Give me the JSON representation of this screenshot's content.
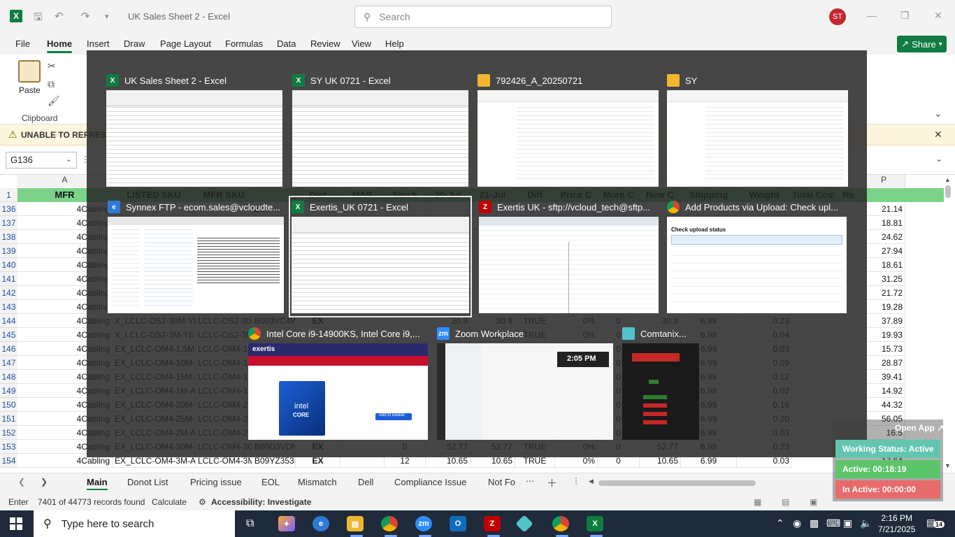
{
  "window": {
    "title": "UK Sales Sheet 2  -  Excel",
    "user_initials": "ST"
  },
  "search": {
    "placeholder": "Search"
  },
  "menu": [
    "File",
    "Home",
    "Insert",
    "Draw",
    "Page Layout",
    "Formulas",
    "Data",
    "Review",
    "View",
    "Help"
  ],
  "menu_active": "Home",
  "share_label": "Share",
  "ribbon": {
    "paste_label": "Paste",
    "clipboard_label": "Clipboard"
  },
  "warning": {
    "text": "UNABLE TO REFRES"
  },
  "namebox": "G136",
  "columns": {
    "A": "A",
    "P": "P"
  },
  "header_row": {
    "row_number": "1",
    "cells": [
      "MFR",
      "LISTED SKU",
      "MFR SKU",
      "",
      "Dist",
      "MAP",
      "Stock",
      "20-Jul",
      "21-Jul",
      "Diff",
      "Price C",
      "More C",
      "New C",
      "Shipping",
      "Weight",
      "Total Cost",
      "Re"
    ]
  },
  "rows": [
    {
      "n": "136",
      "mfr": "4Cabling",
      "listed": "",
      "mfrsku": "",
      "asin": "B00",
      "dist": "",
      "map": "",
      "stock": "",
      "jul20": "",
      "jul21": "",
      "diff": "",
      "pc": "",
      "mc": "",
      "newc": "",
      "ship": "",
      "weight": "",
      "total": "21.14"
    },
    {
      "n": "137",
      "mfr": "4Cabling",
      "listed": "",
      "mfrsku": "",
      "asin": "",
      "dist": "",
      "map": "",
      "stock": "",
      "jul20": "",
      "jul21": "",
      "diff": "",
      "pc": "",
      "mc": "",
      "newc": "",
      "ship": "",
      "weight": "",
      "total": "18.81"
    },
    {
      "n": "138",
      "mfr": "4Cabling",
      "listed": "",
      "mfrsku": "",
      "asin": "",
      "dist": "",
      "map": "",
      "stock": "",
      "jul20": "",
      "jul21": "",
      "diff": "",
      "pc": "",
      "mc": "",
      "newc": "",
      "ship": "",
      "weight": "",
      "total": "24.62"
    },
    {
      "n": "139",
      "mfr": "4Cabling",
      "listed": "",
      "mfrsku": "",
      "asin": "",
      "dist": "",
      "map": "",
      "stock": "",
      "jul20": "",
      "jul21": "",
      "diff": "",
      "pc": "",
      "mc": "",
      "newc": "",
      "ship": "",
      "weight": "",
      "total": "27.94"
    },
    {
      "n": "140",
      "mfr": "4Cabling",
      "listed": "",
      "mfrsku": "",
      "asin": "",
      "dist": "",
      "map": "",
      "stock": "",
      "jul20": "",
      "jul21": "",
      "diff": "",
      "pc": "",
      "mc": "",
      "newc": "",
      "ship": "",
      "weight": "",
      "total": "18.61"
    },
    {
      "n": "141",
      "mfr": "4Cabling",
      "listed": "",
      "mfrsku": "",
      "asin": "",
      "dist": "",
      "map": "",
      "stock": "",
      "jul20": "",
      "jul21": "",
      "diff": "",
      "pc": "",
      "mc": "",
      "newc": "",
      "ship": "",
      "weight": "",
      "total": "31.25"
    },
    {
      "n": "142",
      "mfr": "4Cabling",
      "listed": "",
      "mfrsku": "",
      "asin": "",
      "dist": "",
      "map": "",
      "stock": "",
      "jul20": "",
      "jul21": "",
      "diff": "",
      "pc": "",
      "mc": "",
      "newc": "",
      "ship": "",
      "weight": "",
      "total": "21.72"
    },
    {
      "n": "143",
      "mfr": "4Cabling",
      "listed": "",
      "mfrsku": "",
      "asin": "",
      "dist": "",
      "map": "",
      "stock": "",
      "jul20": "",
      "jul21": "",
      "diff": "",
      "pc": "",
      "mc": "",
      "newc": "",
      "ship": "",
      "weight": "",
      "total": "19.28"
    },
    {
      "n": "144",
      "mfr": "4Cabling",
      "listed": "X_LCLC-OS2-30M-YELLO",
      "mfrsku": "LCLC-OS2-30M-YELLOW",
      "asin": "B003VC4WV0",
      "dist": "EX",
      "map": "",
      "stock": "",
      "jul20": "30.9",
      "jul21": "30.9",
      "diff": "TRUE",
      "pc": "0%",
      "mc": "0",
      "newc": "30.9",
      "ship": "6.99",
      "weight": "0.23",
      "total": "37.89"
    },
    {
      "n": "145",
      "mfr": "4Cabling",
      "listed": "X_LCLC-OS2-3M-YELLO",
      "mfrsku": "LCLC-OS2-3M-YE",
      "asin": "",
      "dist": "",
      "map": "",
      "stock": "",
      "jul20": "",
      "jul21": "12.94",
      "diff": "TRUE",
      "pc": "0%",
      "mc": "0",
      "newc": "12.94",
      "ship": "6.99",
      "weight": "0.04",
      "total": "19.93"
    },
    {
      "n": "146",
      "mfr": "4Cabling",
      "listed": "EX_LCLC-OM4-1.5M-AQUA",
      "mfrsku": "LCLC-OM4-1.5",
      "asin": "",
      "dist": "",
      "map": "",
      "stock": "",
      "jul20": "",
      "jul21": "",
      "diff": "",
      "pc": "",
      "mc": "0",
      "newc": "8.74",
      "ship": "6.99",
      "weight": "0.03",
      "total": "15.73"
    },
    {
      "n": "147",
      "mfr": "4Cabling",
      "listed": "EX_LCLC-OM4-10M-AQUA",
      "mfrsku": "LCLC-OM4-10M",
      "asin": "",
      "dist": "",
      "map": "",
      "stock": "",
      "jul20": "",
      "jul21": "",
      "diff": "",
      "pc": "",
      "mc": "0",
      "newc": "21.88",
      "ship": "6.99",
      "weight": "0.09",
      "total": "28.87"
    },
    {
      "n": "148",
      "mfr": "4Cabling",
      "listed": "EX_LCLC-OM4-15M-AQUA",
      "mfrsku": "LCLC-OM4-15M",
      "asin": "",
      "dist": "",
      "map": "",
      "stock": "",
      "jul20": "",
      "jul21": "",
      "diff": "",
      "pc": "",
      "mc": "0",
      "newc": "32.42",
      "ship": "6.99",
      "weight": "0.12",
      "total": "39.41"
    },
    {
      "n": "149",
      "mfr": "4Cabling",
      "listed": "EX_LCLC-OM4-1M-AQUA",
      "mfrsku": "LCLC-OM4-1M",
      "asin": "",
      "dist": "",
      "map": "",
      "stock": "",
      "jul20": "",
      "jul21": "",
      "diff": "",
      "pc": "",
      "mc": "0",
      "newc": "7.93",
      "ship": "6.99",
      "weight": "0.02",
      "total": "14.92"
    },
    {
      "n": "150",
      "mfr": "4Cabling",
      "listed": "EX_LCLC-OM4-20M-AQUA",
      "mfrsku": "LCLC-OM4-20M",
      "asin": "",
      "dist": "",
      "map": "",
      "stock": "",
      "jul20": "",
      "jul21": "",
      "diff": "",
      "pc": "",
      "mc": "0",
      "newc": "37.33",
      "ship": "6.99",
      "weight": "0.16",
      "total": "44.32"
    },
    {
      "n": "151",
      "mfr": "4Cabling",
      "listed": "EX_LCLC-OM4-25M-AQUA",
      "mfrsku": "LCLC-OM4-25M",
      "asin": "",
      "dist": "",
      "map": "",
      "stock": "",
      "jul20": "",
      "jul21": "",
      "diff": "",
      "pc": "",
      "mc": "0",
      "newc": "49.06",
      "ship": "6.99",
      "weight": "0.20",
      "total": "56.05"
    },
    {
      "n": "152",
      "mfr": "4Cabling",
      "listed": "EX_LCLC-OM4-2M-AQUA",
      "mfrsku": "LCLC-OM4-2M",
      "asin": "",
      "dist": "",
      "map": "",
      "stock": "",
      "jul20": "",
      "jul21": "",
      "diff": "",
      "pc": "",
      "mc": "0",
      "newc": "9.51",
      "ship": "6.99",
      "weight": "0.03",
      "total": "16.5"
    },
    {
      "n": "153",
      "mfr": "4Cabling",
      "listed": "EX_LCLC-OM4-30M-AQUA",
      "mfrsku": "LCLC-OM4-30M",
      "asin": "B00D3VDN4SH",
      "dist": "EX",
      "map": "",
      "stock": "0",
      "jul20": "52.77",
      "jul21": "52.77",
      "diff": "TRUE",
      "pc": "0%",
      "mc": "0",
      "newc": "52.77",
      "ship": "6.99",
      "weight": "0.23",
      "total": "59.76"
    },
    {
      "n": "154",
      "mfr": "4Cabling",
      "listed": "EX_LCLC-OM4-3M-AQUA",
      "mfrsku": "LCLC-OM4-3M-AQUA",
      "asin": "B09YZ353DD",
      "dist": "EX",
      "map": "",
      "stock": "12",
      "jul20": "10.65",
      "jul21": "10.65",
      "diff": "TRUE",
      "pc": "0%",
      "mc": "0",
      "newc": "10.65",
      "ship": "6.99",
      "weight": "0.03",
      "total": "17.64"
    }
  ],
  "sheet_tabs": [
    "Main",
    "Donot List",
    "Pricing issue",
    "EOL",
    "Mismatch",
    "Dell",
    "Compliance Issue",
    "Not Fo"
  ],
  "sheet_active": "Main",
  "status": {
    "mode": "Enter",
    "records": "7401 of 44773 records found",
    "calc": "Calculate",
    "accessibility": "Accessibility: Investigate"
  },
  "switcher": [
    {
      "title": "UK Sales Sheet 2 - Excel",
      "icon": "excel-icon",
      "kind": "excel"
    },
    {
      "title": "SY UK 0721 - Excel",
      "icon": "excel-icon",
      "kind": "excel"
    },
    {
      "title": "792426_A_20250721",
      "icon": "folder-icon",
      "kind": "explorer"
    },
    {
      "title": "SY",
      "icon": "folder-icon",
      "kind": "explorer"
    },
    {
      "title": "Synnex FTP - ecom.sales@vcloudte...",
      "icon": "edge-icon",
      "kind": "web"
    },
    {
      "title": "Exertis_UK 0721 - Excel",
      "icon": "excel-icon",
      "kind": "excel"
    },
    {
      "title": "Exertis UK - sftp://vcloud_tech@sftp...",
      "icon": "filezilla-icon",
      "kind": "filezilla"
    },
    {
      "title": "Add Products via Upload: Check upl...",
      "icon": "chrome-icon",
      "kind": "upload"
    },
    {
      "title": "Intel Core i9-14900KS, Intel Core i9,...",
      "icon": "chrome-icon",
      "kind": "exertis-web"
    },
    {
      "title": "Zoom Workplace",
      "icon": "zoom-icon",
      "kind": "zoom"
    },
    {
      "title": "Comtanix...",
      "icon": "comtanix-icon",
      "kind": "comtanix"
    }
  ],
  "thumb_text": {
    "exertis": "exertis",
    "intel": "intel",
    "core": "CORE",
    "add_to_basket": "Add to basket",
    "zoom_time": "2:05 PM",
    "upload_heading": "Check upload status"
  },
  "work_widget": {
    "open_app": "Open App ↗",
    "status": "Working Status: Active",
    "active": "Active: 00:18:19",
    "inactive": "In Active: 00:00:00"
  },
  "taskbar": {
    "search_placeholder": "Type here to search",
    "time": "2:16 PM",
    "date": "7/21/2025",
    "notifications": "14"
  },
  "colors": {
    "excel_green": "#107c41",
    "header_green": "#7bd389",
    "active_green": "#5cc46a",
    "inactive_red": "#e86a6a",
    "status_teal": "#63c5b0"
  }
}
